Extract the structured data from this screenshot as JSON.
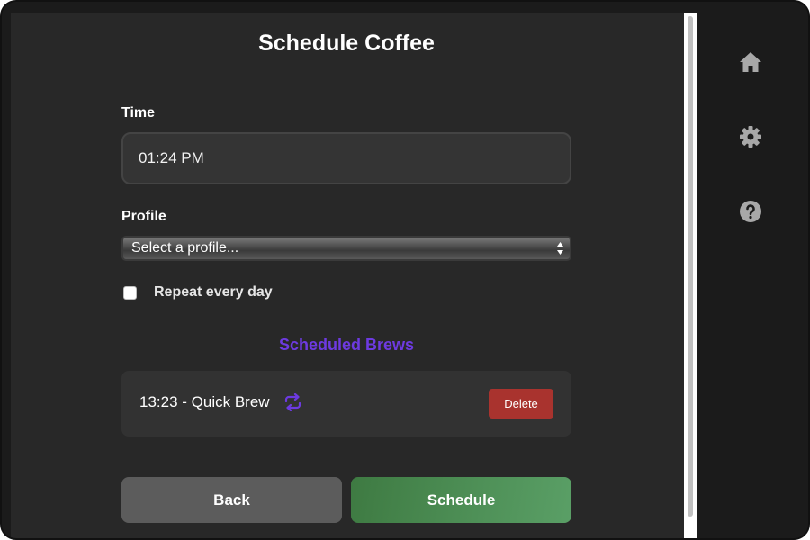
{
  "page": {
    "title": "Schedule Coffee"
  },
  "form": {
    "time_label": "Time",
    "time_value": "01:24 PM",
    "profile_label": "Profile",
    "profile_selected": "Select a profile...",
    "repeat_label": "Repeat every day",
    "repeat_checked": false
  },
  "scheduled": {
    "title": "Scheduled Brews",
    "items": [
      {
        "text": "13:23 - Quick Brew",
        "repeat": true,
        "delete_label": "Delete"
      }
    ]
  },
  "buttons": {
    "back_label": "Back",
    "schedule_label": "Schedule"
  },
  "sidebar": {
    "icons": [
      "home-icon",
      "gear-icon",
      "help-icon"
    ]
  },
  "colors": {
    "accent": "#6d3ae0",
    "delete": "#a9332e",
    "schedule": "#4f9158",
    "back": "#5c5c5c",
    "panel": "#282828",
    "background": "#1b1b1b"
  }
}
